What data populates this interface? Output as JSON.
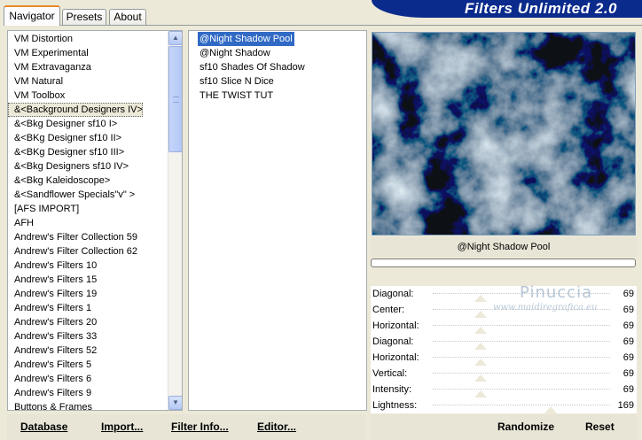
{
  "tabs": [
    {
      "label": "Navigator",
      "active": true
    },
    {
      "label": "Presets",
      "active": false
    },
    {
      "label": "About",
      "active": false
    }
  ],
  "banner": {
    "title": "Filters Unlimited 2.0"
  },
  "filter_list": {
    "selected_index": 5,
    "items": [
      "VM Distortion",
      "VM Experimental",
      "VM Extravaganza",
      "VM Natural",
      "VM Toolbox",
      "&<Background Designers IV>",
      "&<Bkg Designer sf10 I>",
      "&<BKg Designer sf10 II>",
      "&<BKg Designer sf10 III>",
      "&<Bkg Designers sf10 IV>",
      "&<Bkg Kaleidoscope>",
      "&<Sandflower Specials\"v\" >",
      "[AFS IMPORT]",
      "AFH",
      "Andrew's Filter Collection 59",
      "Andrew's Filter Collection 62",
      "Andrew's Filters 10",
      "Andrew's Filters 15",
      "Andrew's Filters 19",
      "Andrew's Filters 1",
      "Andrew's Filters 20",
      "Andrew's Filters 33",
      "Andrew's Filters 52",
      "Andrew's Filters 5",
      "Andrew's Filters 6",
      "Andrew's Filters 9",
      "Buttons & Frames"
    ]
  },
  "effect_list": {
    "selected_index": 0,
    "items": [
      "@Night Shadow Pool",
      "@Night Shadow",
      "sf10 Shades Of Shadow",
      "sf10 Slice N Dice",
      "THE TWIST TUT"
    ]
  },
  "preview": {
    "effect_name": "@Night Shadow Pool",
    "progress_percent": 0
  },
  "watermark": {
    "title": "Pinuccia",
    "url": "www.maidiregrafica.eu"
  },
  "parameters": [
    {
      "label": "Diagonal:",
      "value": "69"
    },
    {
      "label": "Center:",
      "value": "69"
    },
    {
      "label": "Horizontal:",
      "value": "69"
    },
    {
      "label": "Diagonal:",
      "value": "69"
    },
    {
      "label": "Horizontal:",
      "value": "69"
    },
    {
      "label": "Vertical:",
      "value": "69"
    },
    {
      "label": "Intensity:",
      "value": "69"
    },
    {
      "label": "Lightness:",
      "value": "169"
    }
  ],
  "buttons": {
    "database": "Database",
    "import": "Import...",
    "filter_info": "Filter Info...",
    "editor": "Editor...",
    "randomize": "Randomize",
    "reset": "Reset"
  },
  "colors": {
    "window_bg": "#ece9d8",
    "banner_bg": "#0a2a8c",
    "selection": "#316ac5",
    "tab_accent": "#e68b2c"
  }
}
